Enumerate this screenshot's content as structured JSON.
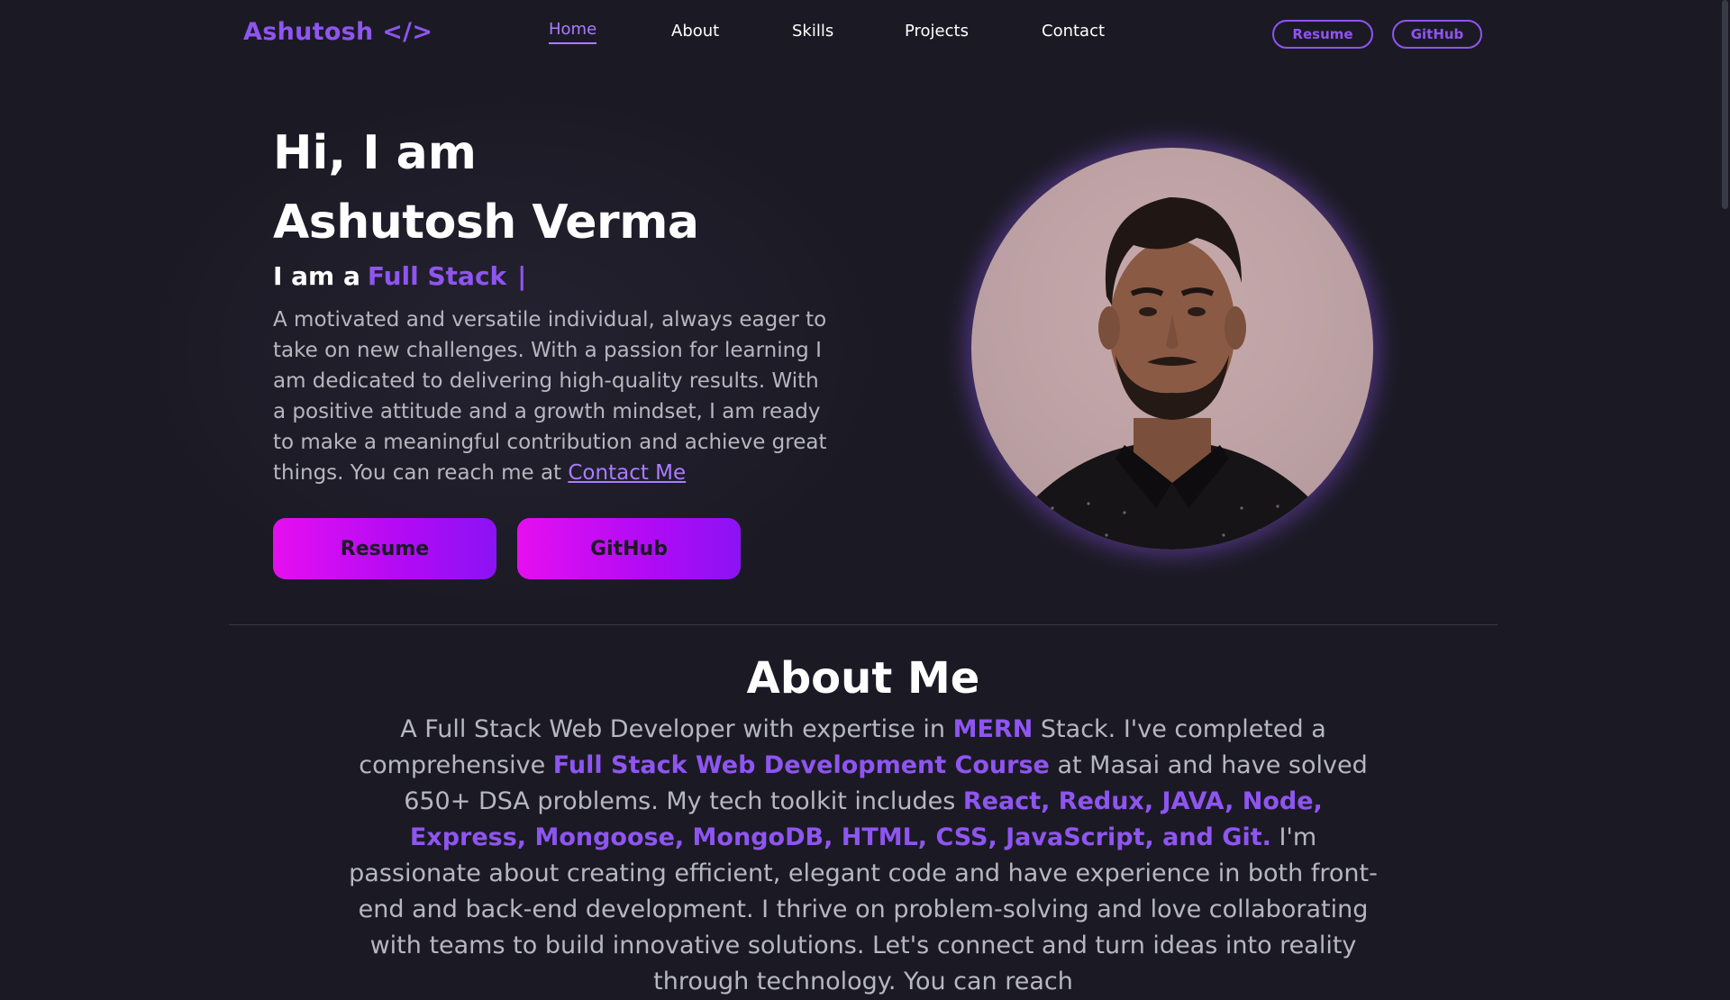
{
  "nav": {
    "logo": "Ashutosh </>",
    "links": [
      "Home",
      "About",
      "Skills",
      "Projects",
      "Contact"
    ],
    "active": "Home",
    "resume_label": "Resume",
    "github_label": "GitHub"
  },
  "hero": {
    "greeting": "Hi, I am",
    "name": "Ashutosh Verma",
    "role_prefix": "I am a",
    "role": "Full Stack",
    "cursor": "|",
    "bio": "A motivated and versatile individual, always eager to take on new challenges. With a passion for learning I am dedicated to delivering high-quality results. With a positive attitude and a growth mindset, I am ready to make a meaningful contribution and achieve great things. You can reach me at",
    "contact_link": "Contact Me",
    "resume_button": "Resume",
    "github_button": "GitHub"
  },
  "about": {
    "title": "About Me",
    "p1": "A Full Stack Web Developer with expertise in",
    "h1": "MERN",
    "p2": "Stack. I've completed a comprehensive",
    "h2": "Full Stack Web Development Course",
    "p3": "at Masai and have solved 650+ DSA problems. My tech toolkit includes",
    "h3": "React, Redux, JAVA, Node, Express, Mongoose, MongoDB, HTML, CSS, JavaScript, and Git.",
    "p4": "I'm passionate about creating efficient, elegant code and have experience in both front-end and back-end development. I thrive on problem-solving and love collaborating with teams to build innovative solutions. Let's connect and turn ideas into reality through technology. You can reach"
  },
  "colors": {
    "background": "#1b1a24",
    "accent": "#8f55f0",
    "button_gradient_start": "#e60ff0",
    "button_gradient_end": "#8b13f4"
  },
  "icons": {
    "profile": "profile-photo"
  }
}
